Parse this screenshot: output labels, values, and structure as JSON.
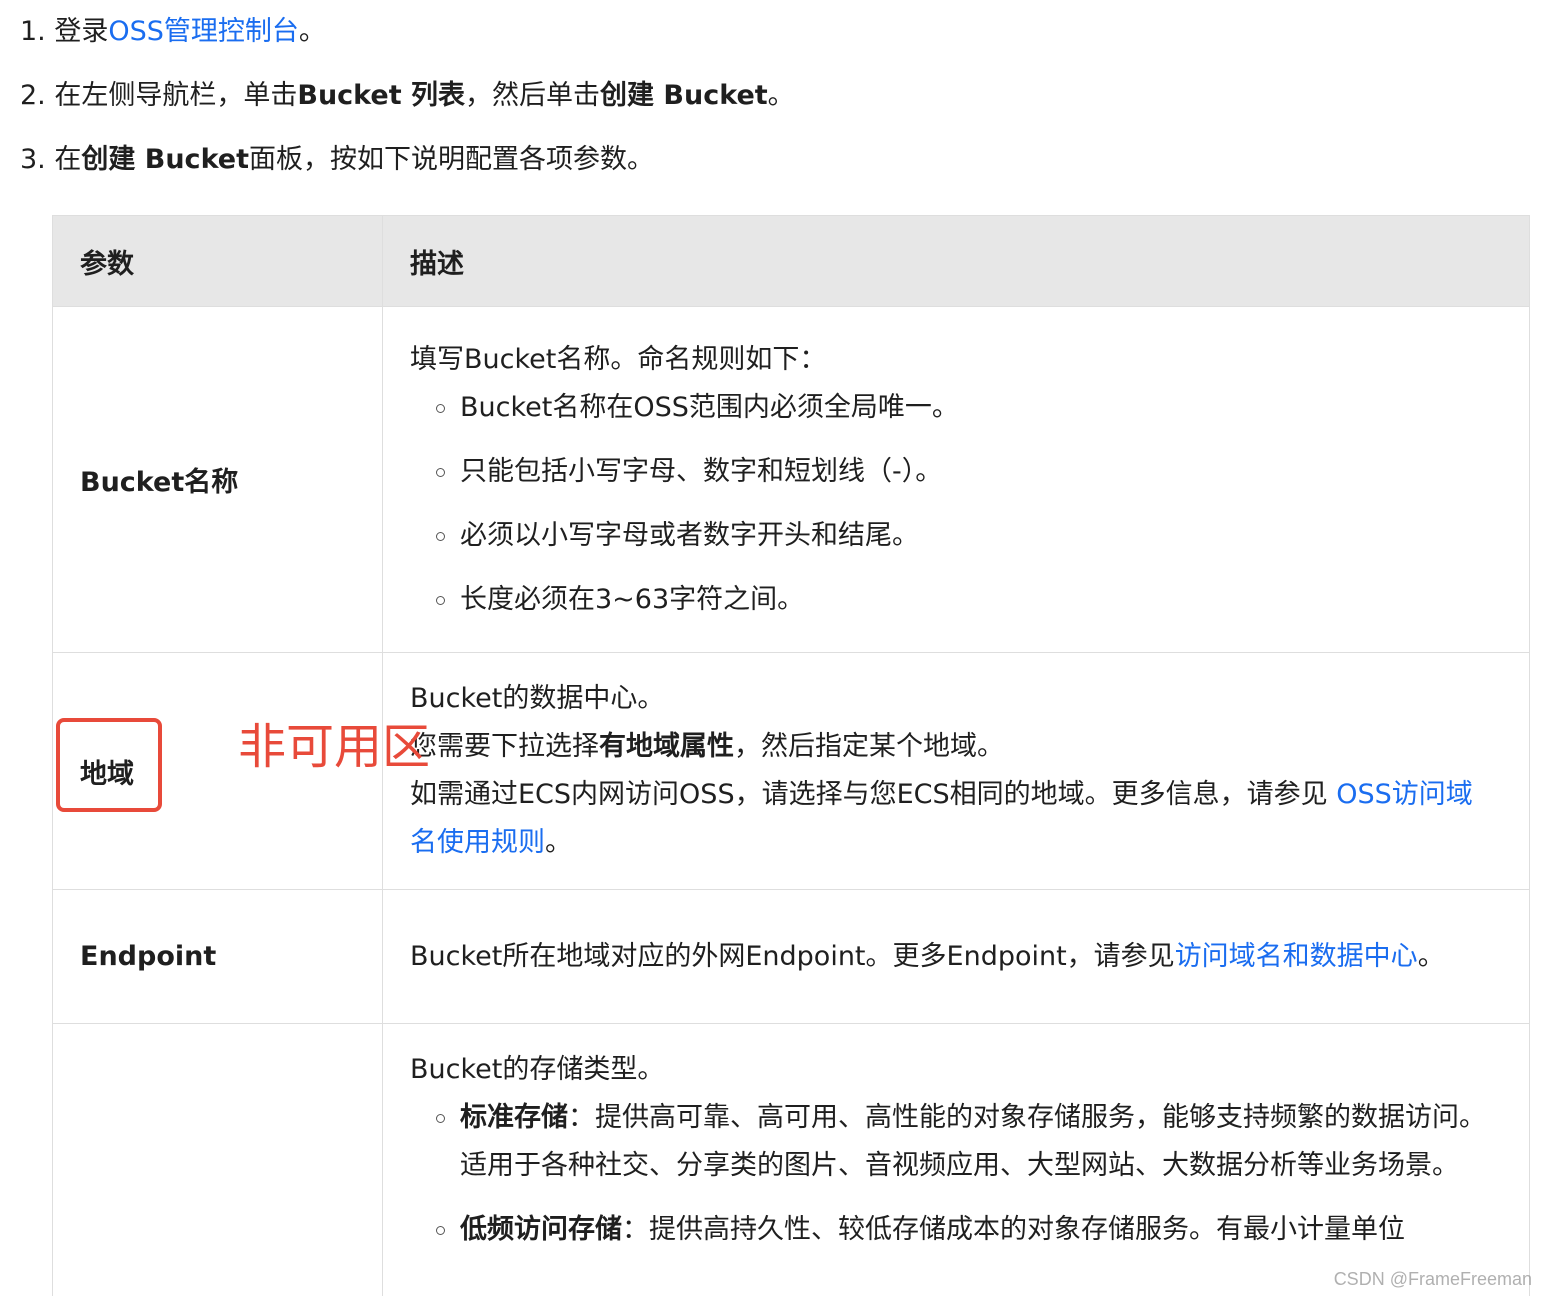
{
  "steps": [
    {
      "num": "1.",
      "text1": "登录",
      "link": "OSS管理控制台",
      "text2": "。"
    },
    {
      "num": "2.",
      "text1": "在左侧导航栏，单击",
      "bold1": "Bucket 列表",
      "text2": "，然后单击",
      "bold2": "创建 Bucket",
      "text3": "。"
    },
    {
      "num": "3.",
      "text1": "在",
      "bold1": "创建 Bucket",
      "text2": "面板，按如下说明配置各项参数。"
    }
  ],
  "table": {
    "header": {
      "param": "参数",
      "desc": "描述"
    },
    "bucket_name": {
      "param": "Bucket名称",
      "intro": "填写Bucket名称。命名规则如下：",
      "rules": [
        "Bucket名称在OSS范围内必须全局唯一。",
        "只能包括小写字母、数字和短划线（-）。",
        "必须以小写字母或者数字开头和结尾。",
        "长度必须在3~63字符之间。"
      ]
    },
    "region": {
      "param": "地域",
      "line1": "Bucket的数据中心。",
      "line2_pre": "您需要下拉选择",
      "line2_bold": "有地域属性",
      "line2_post": "，然后指定某个地域。",
      "line3_pre": "如需通过ECS内网访问OSS，请选择与您ECS相同的地域。更多信息，请参见 ",
      "line3_link": "OSS访问域名使用规则",
      "line3_post": "。"
    },
    "endpoint": {
      "param": "Endpoint",
      "pre": "Bucket所在地域对应的外网Endpoint。更多Endpoint，请参见",
      "link": "访问域名和数据中心",
      "post": "。"
    },
    "storage": {
      "param": "",
      "intro": "Bucket的存储类型。",
      "items": [
        {
          "lead": "标准存储",
          "text": "：提供高可靠、高可用、高性能的对象存储服务，能够支持频繁的数据访问。适用于各种社交、分享类的图片、音视频应用、大型网站、大数据分析等业务场景。"
        },
        {
          "lead": "低频访问存储",
          "text": "：提供高持久性、较低存储成本的对象存储服务。有最小计量单位"
        }
      ]
    }
  },
  "annotation": {
    "text": "非可用区",
    "color": "#e84a3a"
  },
  "watermark": "CSDN @FrameFreeman",
  "colors": {
    "link": "#1a6df0",
    "header_bg": "#e7e7e7",
    "border": "#dedede"
  }
}
